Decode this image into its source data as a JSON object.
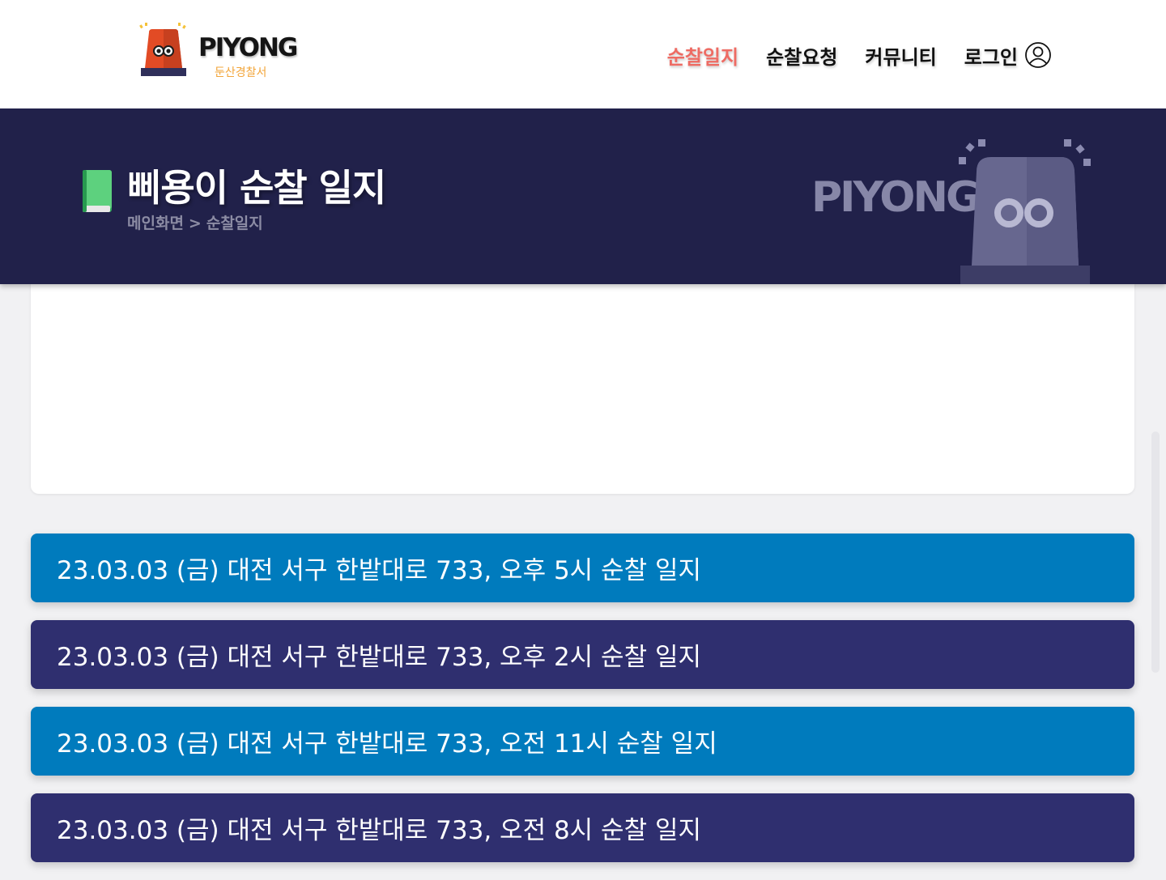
{
  "header": {
    "logo_text": "PIYONG",
    "logo_sub": "둔산경찰서",
    "nav": [
      {
        "label": "순찰일지",
        "active": true
      },
      {
        "label": "순찰요청",
        "active": false
      },
      {
        "label": "커뮤니티",
        "active": false
      },
      {
        "label": "로그인",
        "active": false
      }
    ],
    "login_icon": "user-circle-icon"
  },
  "banner": {
    "icon": "green-book-icon",
    "title": "삐용이 순찰 일지",
    "breadcrumb": {
      "home": "메인화면",
      "separator": ">",
      "current": "순찰일지"
    },
    "logo_text": "PIYONG"
  },
  "logs": [
    {
      "label": "23.03.03 (금) 대전 서구 한밭대로 733, 오후 5시 순찰 일지",
      "color": "#007bbd"
    },
    {
      "label": "23.03.03 (금) 대전 서구 한밭대로 733, 오후 2시 순찰 일지",
      "color": "#2f2f6f"
    },
    {
      "label": "23.03.03 (금) 대전 서구 한밭대로 733, 오전 11시 순찰 일지",
      "color": "#007bbd"
    },
    {
      "label": "23.03.03 (금) 대전 서구 한밭대로 733, 오전 8시 순찰 일지",
      "color": "#2f2f6f"
    }
  ],
  "colors": {
    "accent": "#ee6b63",
    "banner": "#21214a",
    "blue_item": "#007bbd",
    "navy_item": "#2f2f6f"
  }
}
